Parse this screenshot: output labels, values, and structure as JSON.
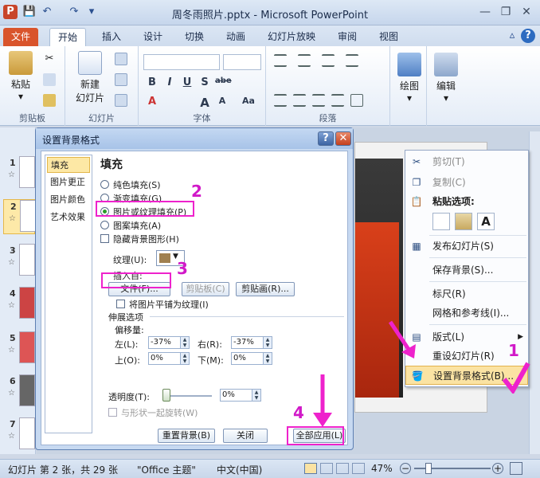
{
  "window": {
    "title": "周冬雨照片.pptx - Microsoft PowerPoint",
    "app_icon": "P"
  },
  "tabs": [
    "文件",
    "开始",
    "插入",
    "设计",
    "切换",
    "动画",
    "幻灯片放映",
    "审阅",
    "视图"
  ],
  "ribbon": {
    "clipboard": {
      "paste": "粘贴",
      "label": "剪贴板"
    },
    "slides": {
      "new_slide": "新建",
      "new_slide2": "幻灯片",
      "label": "幻灯片"
    },
    "font": {
      "label": "字体",
      "bold": "B",
      "italic": "I",
      "underline": "U",
      "strike": "S",
      "shadow": "abe",
      "grow": "A",
      "shrink": "A",
      "color": "A",
      "aa": "Aa"
    },
    "paragraph": {
      "label": "段落"
    },
    "drawing": {
      "label": "绘图"
    },
    "editing": {
      "label": "编辑"
    }
  },
  "thumbnails": [
    "1",
    "2",
    "3",
    "4",
    "5",
    "6",
    "7"
  ],
  "dialog": {
    "title": "设置背景格式",
    "help": "?",
    "close": "✕",
    "nav": [
      "填充",
      "图片更正",
      "图片颜色",
      "艺术效果"
    ],
    "heading": "填充",
    "options": {
      "solid": "纯色填充(S)",
      "gradient": "渐变填充(G)",
      "picture": "图片或纹理填充(P)",
      "pattern": "图案填充(A)",
      "hide_bg": "隐藏背景图形(H)"
    },
    "texture_label": "纹理(U):",
    "insert_from": "插入自:",
    "file_btn": "文件(F)...",
    "clipboard_btn": "剪贴板(C)",
    "clipart_btn": "剪贴画(R)...",
    "tile": "将图片平铺为纹理(I)",
    "stretch": "伸展选项",
    "offset": "偏移量:",
    "left_label": "左(L):",
    "left_val": "-37%",
    "right_label": "右(R):",
    "right_val": "-37%",
    "top_label": "上(O):",
    "top_val": "0%",
    "bottom_label": "下(M):",
    "bottom_val": "0%",
    "transparency_label": "透明度(T):",
    "transparency_val": "0%",
    "transparency_level": 0,
    "rotate_with_shape": "与形状一起旋转(W)",
    "reset_btn": "重置背景(B)",
    "close_btn": "关闭",
    "apply_all_btn": "全部应用(L)"
  },
  "context_menu": {
    "cut": "剪切(T)",
    "copy": "复制(C)",
    "paste_options": "粘贴选项:",
    "publish": "发布幻灯片(S)",
    "save_bg": "保存背景(S)...",
    "ruler": "标尺(R)",
    "grid": "网格和参考线(I)...",
    "layout": "版式(L)",
    "reset": "重设幻灯片(R)",
    "format_bg": "设置背景格式(B)..."
  },
  "annotations": [
    "1",
    "2",
    "3",
    "4"
  ],
  "status": {
    "slide": "幻灯片 第 2 张，共 29 张",
    "theme": "\"Office 主题\"",
    "lang": "中文(中国)",
    "zoom": "47%"
  },
  "colors": {
    "accent_file_tab": "#d9542c",
    "highlight": "#ee22cc",
    "selected": "#fde8a5"
  }
}
